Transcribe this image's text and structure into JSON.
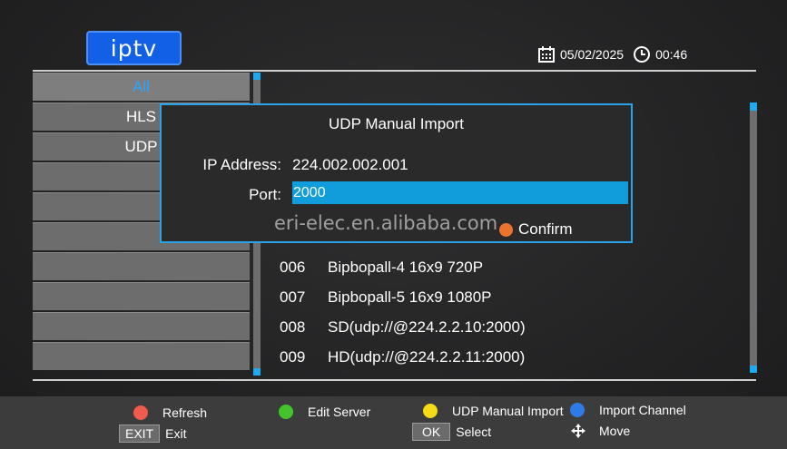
{
  "logo": "iptv",
  "header": {
    "date": "05/02/2025",
    "time": "00:46"
  },
  "sidebar": {
    "items": [
      {
        "label": "All",
        "active": true
      },
      {
        "label": "HLS",
        "active": false
      },
      {
        "label": "UDP",
        "active": false
      },
      {
        "label": "",
        "active": false
      },
      {
        "label": "",
        "active": false
      },
      {
        "label": "",
        "active": false
      },
      {
        "label": "",
        "active": false
      },
      {
        "label": "",
        "active": false
      },
      {
        "label": "",
        "active": false
      },
      {
        "label": "",
        "active": false
      }
    ]
  },
  "channels": [
    {
      "num": "006",
      "name": "Bipbopall-4 16x9 720P"
    },
    {
      "num": "007",
      "name": "Bipbopall-5 16x9 1080P"
    },
    {
      "num": "008",
      "name": "SD(udp://@224.2.2.10:2000)"
    },
    {
      "num": "009",
      "name": "HD(udp://@224.2.2.11:2000)"
    }
  ],
  "dialog": {
    "title": "UDP Manual Import",
    "ip_label": "IP Address:",
    "ip_value": "224.002.002.001",
    "port_label": "Port:",
    "port_value": "2000",
    "confirm_label": "Confirm",
    "watermark": "eri-elec.en.alibaba.com"
  },
  "footer": {
    "red_label": "Refresh",
    "green_label": "Edit Server",
    "yellow_label": "UDP Manual Import",
    "blue_label": "Import Channel",
    "exit_key": "EXIT",
    "exit_label": "Exit",
    "ok_key": "OK",
    "ok_label": "Select",
    "move_label": "Move"
  },
  "colors": {
    "accent": "#1eaaf1",
    "red": "#ef5b4c",
    "green": "#43c42a",
    "yellow": "#f5dc16",
    "blue": "#2d7be6"
  }
}
